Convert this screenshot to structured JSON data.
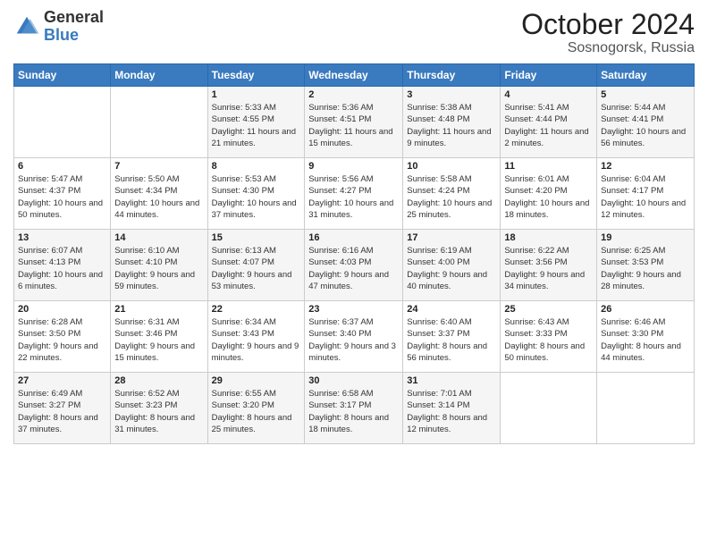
{
  "logo": {
    "general": "General",
    "blue": "Blue"
  },
  "title": "October 2024",
  "location": "Sosnogorsk, Russia",
  "days_header": [
    "Sunday",
    "Monday",
    "Tuesday",
    "Wednesday",
    "Thursday",
    "Friday",
    "Saturday"
  ],
  "weeks": [
    [
      {
        "day": "",
        "info": ""
      },
      {
        "day": "",
        "info": ""
      },
      {
        "day": "1",
        "info": "Sunrise: 5:33 AM\nSunset: 4:55 PM\nDaylight: 11 hours and 21 minutes."
      },
      {
        "day": "2",
        "info": "Sunrise: 5:36 AM\nSunset: 4:51 PM\nDaylight: 11 hours and 15 minutes."
      },
      {
        "day": "3",
        "info": "Sunrise: 5:38 AM\nSunset: 4:48 PM\nDaylight: 11 hours and 9 minutes."
      },
      {
        "day": "4",
        "info": "Sunrise: 5:41 AM\nSunset: 4:44 PM\nDaylight: 11 hours and 2 minutes."
      },
      {
        "day": "5",
        "info": "Sunrise: 5:44 AM\nSunset: 4:41 PM\nDaylight: 10 hours and 56 minutes."
      }
    ],
    [
      {
        "day": "6",
        "info": "Sunrise: 5:47 AM\nSunset: 4:37 PM\nDaylight: 10 hours and 50 minutes."
      },
      {
        "day": "7",
        "info": "Sunrise: 5:50 AM\nSunset: 4:34 PM\nDaylight: 10 hours and 44 minutes."
      },
      {
        "day": "8",
        "info": "Sunrise: 5:53 AM\nSunset: 4:30 PM\nDaylight: 10 hours and 37 minutes."
      },
      {
        "day": "9",
        "info": "Sunrise: 5:56 AM\nSunset: 4:27 PM\nDaylight: 10 hours and 31 minutes."
      },
      {
        "day": "10",
        "info": "Sunrise: 5:58 AM\nSunset: 4:24 PM\nDaylight: 10 hours and 25 minutes."
      },
      {
        "day": "11",
        "info": "Sunrise: 6:01 AM\nSunset: 4:20 PM\nDaylight: 10 hours and 18 minutes."
      },
      {
        "day": "12",
        "info": "Sunrise: 6:04 AM\nSunset: 4:17 PM\nDaylight: 10 hours and 12 minutes."
      }
    ],
    [
      {
        "day": "13",
        "info": "Sunrise: 6:07 AM\nSunset: 4:13 PM\nDaylight: 10 hours and 6 minutes."
      },
      {
        "day": "14",
        "info": "Sunrise: 6:10 AM\nSunset: 4:10 PM\nDaylight: 9 hours and 59 minutes."
      },
      {
        "day": "15",
        "info": "Sunrise: 6:13 AM\nSunset: 4:07 PM\nDaylight: 9 hours and 53 minutes."
      },
      {
        "day": "16",
        "info": "Sunrise: 6:16 AM\nSunset: 4:03 PM\nDaylight: 9 hours and 47 minutes."
      },
      {
        "day": "17",
        "info": "Sunrise: 6:19 AM\nSunset: 4:00 PM\nDaylight: 9 hours and 40 minutes."
      },
      {
        "day": "18",
        "info": "Sunrise: 6:22 AM\nSunset: 3:56 PM\nDaylight: 9 hours and 34 minutes."
      },
      {
        "day": "19",
        "info": "Sunrise: 6:25 AM\nSunset: 3:53 PM\nDaylight: 9 hours and 28 minutes."
      }
    ],
    [
      {
        "day": "20",
        "info": "Sunrise: 6:28 AM\nSunset: 3:50 PM\nDaylight: 9 hours and 22 minutes."
      },
      {
        "day": "21",
        "info": "Sunrise: 6:31 AM\nSunset: 3:46 PM\nDaylight: 9 hours and 15 minutes."
      },
      {
        "day": "22",
        "info": "Sunrise: 6:34 AM\nSunset: 3:43 PM\nDaylight: 9 hours and 9 minutes."
      },
      {
        "day": "23",
        "info": "Sunrise: 6:37 AM\nSunset: 3:40 PM\nDaylight: 9 hours and 3 minutes."
      },
      {
        "day": "24",
        "info": "Sunrise: 6:40 AM\nSunset: 3:37 PM\nDaylight: 8 hours and 56 minutes."
      },
      {
        "day": "25",
        "info": "Sunrise: 6:43 AM\nSunset: 3:33 PM\nDaylight: 8 hours and 50 minutes."
      },
      {
        "day": "26",
        "info": "Sunrise: 6:46 AM\nSunset: 3:30 PM\nDaylight: 8 hours and 44 minutes."
      }
    ],
    [
      {
        "day": "27",
        "info": "Sunrise: 6:49 AM\nSunset: 3:27 PM\nDaylight: 8 hours and 37 minutes."
      },
      {
        "day": "28",
        "info": "Sunrise: 6:52 AM\nSunset: 3:23 PM\nDaylight: 8 hours and 31 minutes."
      },
      {
        "day": "29",
        "info": "Sunrise: 6:55 AM\nSunset: 3:20 PM\nDaylight: 8 hours and 25 minutes."
      },
      {
        "day": "30",
        "info": "Sunrise: 6:58 AM\nSunset: 3:17 PM\nDaylight: 8 hours and 18 minutes."
      },
      {
        "day": "31",
        "info": "Sunrise: 7:01 AM\nSunset: 3:14 PM\nDaylight: 8 hours and 12 minutes."
      },
      {
        "day": "",
        "info": ""
      },
      {
        "day": "",
        "info": ""
      }
    ]
  ]
}
